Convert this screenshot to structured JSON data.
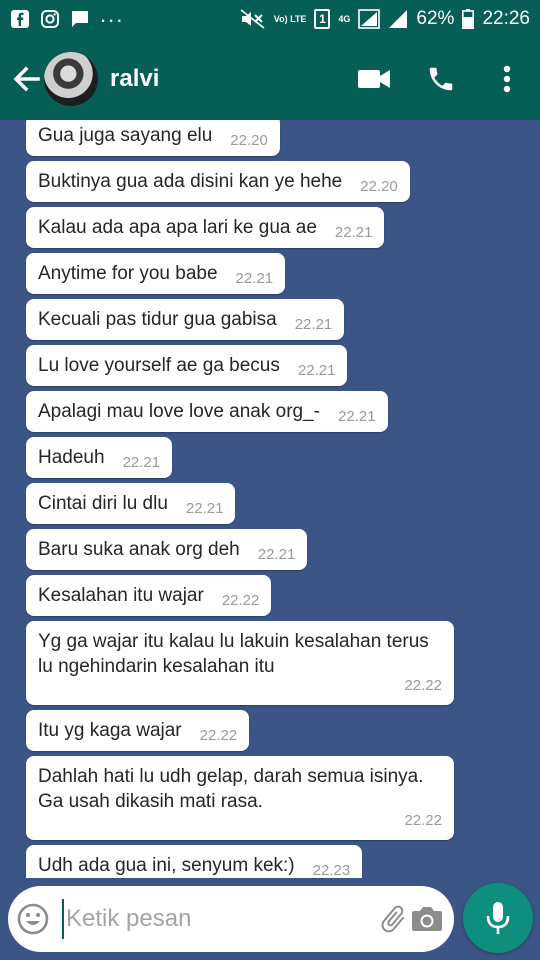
{
  "status_bar": {
    "battery": "62%",
    "time": "22:26",
    "dots": "...",
    "volte_label": "Vo) LTE",
    "sim_label": "1",
    "network_label": "4G"
  },
  "header": {
    "contact_name": "ralvi"
  },
  "messages": [
    {
      "text": "Gua juga sayang elu",
      "time": "22.20"
    },
    {
      "text": "Buktinya gua ada disini kan ye hehe",
      "time": "22.20"
    },
    {
      "text": "Kalau ada apa apa lari ke gua ae",
      "time": "22.21"
    },
    {
      "text": "Anytime for you babe",
      "time": "22.21"
    },
    {
      "text": "Kecuali pas tidur gua gabisa",
      "time": "22.21"
    },
    {
      "text": "Lu love yourself ae ga becus",
      "time": "22.21"
    },
    {
      "text": "Apalagi mau love love anak org_-",
      "time": "22.21"
    },
    {
      "text": "Hadeuh",
      "time": "22.21"
    },
    {
      "text": "Cintai diri lu dlu",
      "time": "22.21"
    },
    {
      "text": "Baru suka anak org deh",
      "time": "22.21"
    },
    {
      "text": "Kesalahan itu wajar",
      "time": "22.22"
    },
    {
      "text": "Yg ga wajar itu kalau lu lakuin kesalahan terus lu ngehindarin kesalahan itu",
      "time": "22.22",
      "multi": true
    },
    {
      "text": "Itu yg kaga wajar",
      "time": "22.22"
    },
    {
      "text": "Dahlah hati lu udh gelap, darah semua isinya. Ga usah dikasih mati rasa.",
      "time": "22.22",
      "multi": true
    },
    {
      "text": "Udh ada gua ini, senyum kek:)",
      "time": "22.23"
    }
  ],
  "input": {
    "placeholder": "Ketik pesan"
  },
  "colors": {
    "header": "#075e54",
    "wallpaper": "#3a5586",
    "bubble": "#ffffff",
    "mic": "#0e8f7d"
  },
  "icons": [
    "facebook-icon",
    "instagram-icon",
    "chat-icon",
    "mute-icon",
    "signal-icon",
    "battery-icon",
    "back-arrow-icon",
    "video-call-icon",
    "phone-icon",
    "more-vert-icon",
    "emoji-icon",
    "attach-icon",
    "camera-icon",
    "mic-icon"
  ]
}
